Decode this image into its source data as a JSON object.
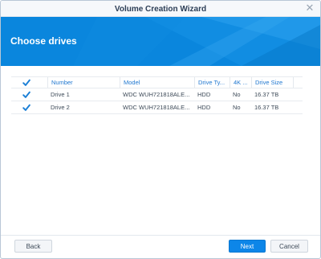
{
  "window": {
    "title": "Volume Creation Wizard",
    "close_glyph": "✕"
  },
  "banner": {
    "heading": "Choose drives",
    "color": "#0a86dd"
  },
  "table": {
    "columns": [
      "Number",
      "Model",
      "Drive Ty...",
      "4K ...",
      "Drive Size"
    ],
    "header_checked": true,
    "rows": [
      {
        "checked": true,
        "number": "Drive 1",
        "model": "WDC WUH721818ALE...",
        "drive_type": "HDD",
        "fourk": "No",
        "size": "16.37 TB"
      },
      {
        "checked": true,
        "number": "Drive 2",
        "model": "WDC WUH721818ALE...",
        "drive_type": "HDD",
        "fourk": "No",
        "size": "16.37 TB"
      }
    ]
  },
  "footer": {
    "back": "Back",
    "next": "Next",
    "cancel": "Cancel"
  },
  "colors": {
    "accent": "#1f77d0",
    "checkbox": "#1b7fd6"
  }
}
